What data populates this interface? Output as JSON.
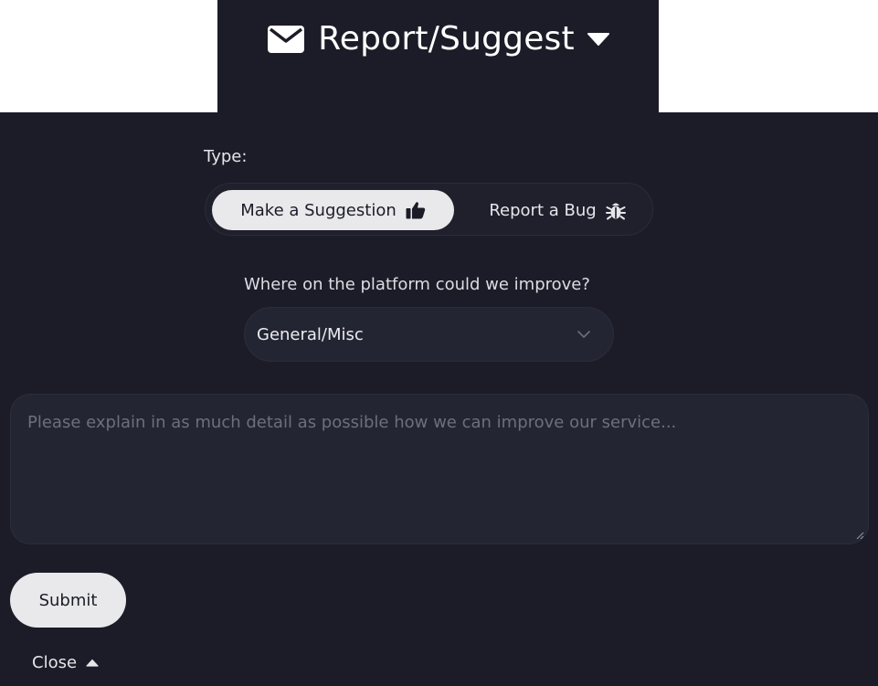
{
  "header": {
    "title": "Report/Suggest",
    "icon": "envelope-icon",
    "dropdown_icon": "caret-down-icon"
  },
  "form": {
    "type_label": "Type:",
    "type_options": [
      {
        "label": "Make a Suggestion",
        "icon": "thumbs-up-icon",
        "selected": true
      },
      {
        "label": "Report a Bug",
        "icon": "bug-icon",
        "selected": false
      }
    ],
    "area_label": "Where on the platform could we improve?",
    "area_select": {
      "value": "General/Misc"
    },
    "details": {
      "placeholder": "Please explain in as much detail as possible how we can improve our service...",
      "value": ""
    },
    "submit_label": "Submit",
    "close_label": "Close"
  },
  "colors": {
    "background": "#1b1c27",
    "field": "#242533",
    "button": "#e9e9ec",
    "placeholder": "#6e6f7d"
  }
}
